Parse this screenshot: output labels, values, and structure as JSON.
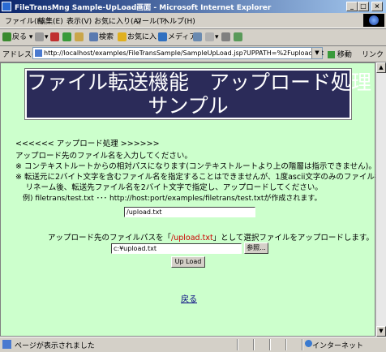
{
  "window": {
    "title": "FileTransMng Sample-UpLoad画面 - Microsoft Internet Explorer"
  },
  "menu": [
    "ファイル(F)",
    "編集(E)",
    "表示(V)",
    "お気に入り(A)",
    "ツール(T)",
    "ヘルプ(H)"
  ],
  "toolbar": {
    "back": "戻る",
    "search": "検索",
    "favorites": "お気に入り",
    "media": "メディア"
  },
  "address": {
    "label": "アドレス(D)",
    "url": "http://localhost/examples/FileTransSample/SampleUpLoad.jsp?UPPATH=%2Fupload.txt",
    "go": "移動",
    "links": "リンク"
  },
  "page": {
    "heading_line1": "ファイル転送機能　アップロード処理",
    "heading_line2": "サンプル",
    "section": "<<<<<<  アップロード処理  >>>>>>",
    "instructions": [
      "アップロード先のファイル名を入力してください。",
      "※ コンテキストルートからの相対パスになります(コンテキストルートより上の階層は指示できません)。",
      "※ 転送元に2バイト文字を含むファイル名を指定することはできませんが、1度ascii文字のみのファイル名に",
      "　 リネーム後、転送先ファイル名を2バイト文字で指定し、アップロードしてください。",
      "　例) filetrans/test.txt ･･･ http://host:port/examples/filetrans/test.txtが作成されます。"
    ],
    "dest_value": "/upload.txt",
    "upload_prefix": "アップロード先のファイルパスを「",
    "upload_path": "/upload.txt",
    "upload_suffix": "」として選択ファイルをアップロードします。",
    "file_value": "c:¥upload.txt",
    "browse_label": "参照...",
    "upload_button": "Up Load",
    "back_link": "戻る"
  },
  "status": {
    "text": "ページが表示されました",
    "zone": "インターネット"
  }
}
